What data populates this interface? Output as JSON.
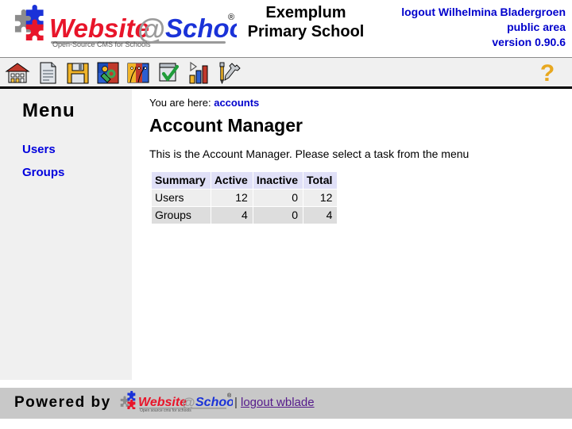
{
  "header": {
    "logo_alt": "Website@School",
    "logo_word_1": "Website",
    "logo_at": "@",
    "logo_word_2": "School",
    "logo_registered": "®",
    "logo_tagline": "Open-Source CMS for Schools",
    "school_name_line1": "Exemplum",
    "school_name_line2": "Primary School",
    "logout_label": "logout Wilhelmina Bladergroen",
    "area_label": "public area",
    "version_label": "version 0.90.6"
  },
  "toolbar": {
    "icons": [
      {
        "name": "home-icon",
        "label": "Home"
      },
      {
        "name": "page-icon",
        "label": "Pages"
      },
      {
        "name": "save-floppy-icon",
        "label": "File manager"
      },
      {
        "name": "modules-puzzle-icon",
        "label": "Modules"
      },
      {
        "name": "accounts-faces-icon",
        "label": "Account manager"
      },
      {
        "name": "checklist-icon",
        "label": "Page manager"
      },
      {
        "name": "statistics-bar-chart-icon",
        "label": "Statistics"
      },
      {
        "name": "tools-screwdriver-wrench-icon",
        "label": "Tools"
      }
    ],
    "help": {
      "name": "help-question-icon",
      "label": "?"
    }
  },
  "sidebar": {
    "title": "Menu",
    "items": [
      {
        "label": "Users"
      },
      {
        "label": "Groups"
      }
    ]
  },
  "content": {
    "breadcrumb_prefix": "You are here:",
    "breadcrumb_current": "accounts",
    "page_title": "Account Manager",
    "intro": "This is the Account Manager. Please select a task from the menu"
  },
  "summary_table": {
    "headers": [
      "Summary",
      "Active",
      "Inactive",
      "Total"
    ],
    "rows": [
      {
        "label": "Users",
        "active": "12",
        "inactive": "0",
        "total": "12"
      },
      {
        "label": "Groups",
        "active": "4",
        "inactive": "0",
        "total": "4"
      }
    ]
  },
  "footer": {
    "powered_by": "Powered by",
    "logo_word_1": "Website",
    "logo_at": "@",
    "logo_word_2": "School",
    "logo_registered": "®",
    "logo_tagline": "Open source cms for schools",
    "separator": "|",
    "logout_label": "logout wblade"
  },
  "colors": {
    "link_blue": "#0000cc",
    "visited_purple": "#551a8b",
    "logo_red": "#e8152a",
    "logo_blue": "#1a32d8",
    "toolbar_bg": "#f0f0f0",
    "sidebar_bg": "#f0f0f0",
    "footer_bg": "#c8c8c8",
    "table_header_bg": "#e0e0f7",
    "row_odd_bg": "#eeeeee",
    "row_even_bg": "#dddddd"
  }
}
